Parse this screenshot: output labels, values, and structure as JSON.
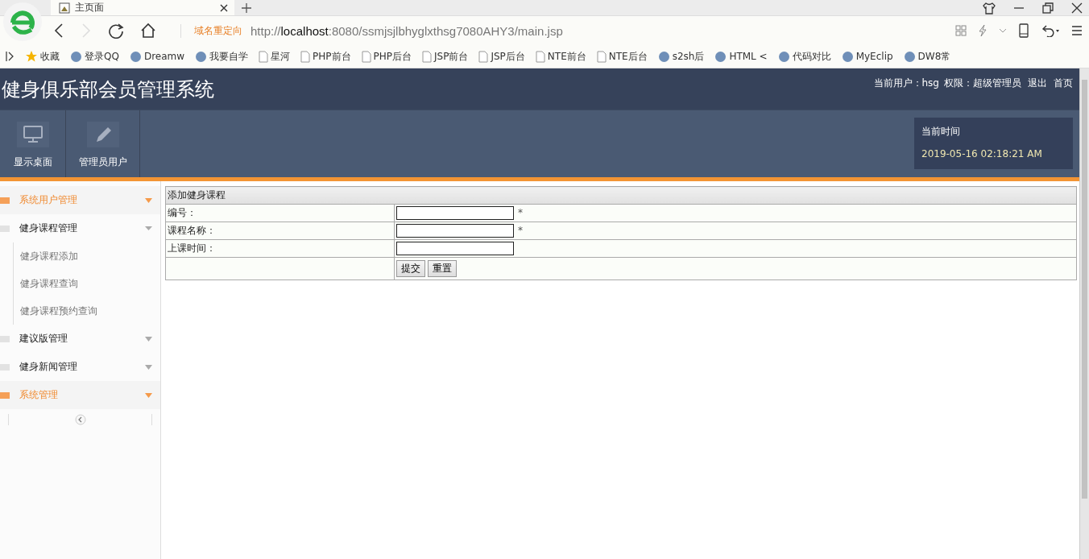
{
  "browser": {
    "tab": {
      "title": "主页面"
    },
    "redirect_label": "域名重定向",
    "url": {
      "prefix": "http://",
      "host": "localhost",
      "rest": ":8080/ssmjsjlbhyglxthsg7080AHY3/main.jsp"
    },
    "bookmarks": [
      {
        "label": "收藏",
        "kind": "star"
      },
      {
        "label": "登录QQ",
        "kind": "site"
      },
      {
        "label": "Dreamw",
        "kind": "site"
      },
      {
        "label": "我要自学",
        "kind": "site"
      },
      {
        "label": "星河",
        "kind": "page"
      },
      {
        "label": "PHP前台",
        "kind": "page"
      },
      {
        "label": "PHP后台",
        "kind": "page"
      },
      {
        "label": "JSP前台",
        "kind": "page"
      },
      {
        "label": "JSP后台",
        "kind": "page"
      },
      {
        "label": "NTE前台",
        "kind": "page"
      },
      {
        "label": "NTE后台",
        "kind": "page"
      },
      {
        "label": "s2sh后",
        "kind": "site"
      },
      {
        "label": "HTML <",
        "kind": "site"
      },
      {
        "label": "代码对比",
        "kind": "site"
      },
      {
        "label": "MyEclip",
        "kind": "site"
      },
      {
        "label": "DW8常",
        "kind": "site"
      }
    ]
  },
  "app": {
    "title": "健身俱乐部会员管理系统",
    "user_bar": [
      {
        "text": "当前用户：hsg",
        "kind": "text"
      },
      {
        "text": "权限：超级管理员",
        "kind": "text"
      },
      {
        "text": "退出",
        "kind": "link"
      },
      {
        "text": "首页",
        "kind": "link"
      }
    ],
    "nav": [
      {
        "label": "显示桌面",
        "kind": "monitor"
      },
      {
        "label": "管理员用户",
        "kind": "pencil"
      }
    ],
    "clock": {
      "label": "当前时间",
      "value": "2019-05-16 02:18:21 AM"
    }
  },
  "sidebar": {
    "groups": [
      {
        "label": "系统用户管理",
        "highlighted": true,
        "expanded": false
      },
      {
        "label": "健身课程管理",
        "highlighted": false,
        "expanded": true,
        "children": [
          {
            "label": "健身课程添加"
          },
          {
            "label": "健身课程查询"
          },
          {
            "label": "健身课程预约查询"
          }
        ]
      },
      {
        "label": "建议版管理",
        "highlighted": false,
        "expanded": false
      },
      {
        "label": "健身新闻管理",
        "highlighted": false,
        "expanded": false
      },
      {
        "label": "系统管理",
        "highlighted": true,
        "expanded": false
      }
    ]
  },
  "form": {
    "title": "添加健身课程",
    "fields": [
      {
        "label": "编号：",
        "required_mark": "*"
      },
      {
        "label": "课程名称：",
        "required_mark": "*"
      },
      {
        "label": "上课时间："
      }
    ],
    "buttons": [
      {
        "label": "提交"
      },
      {
        "label": "重置"
      }
    ]
  }
}
